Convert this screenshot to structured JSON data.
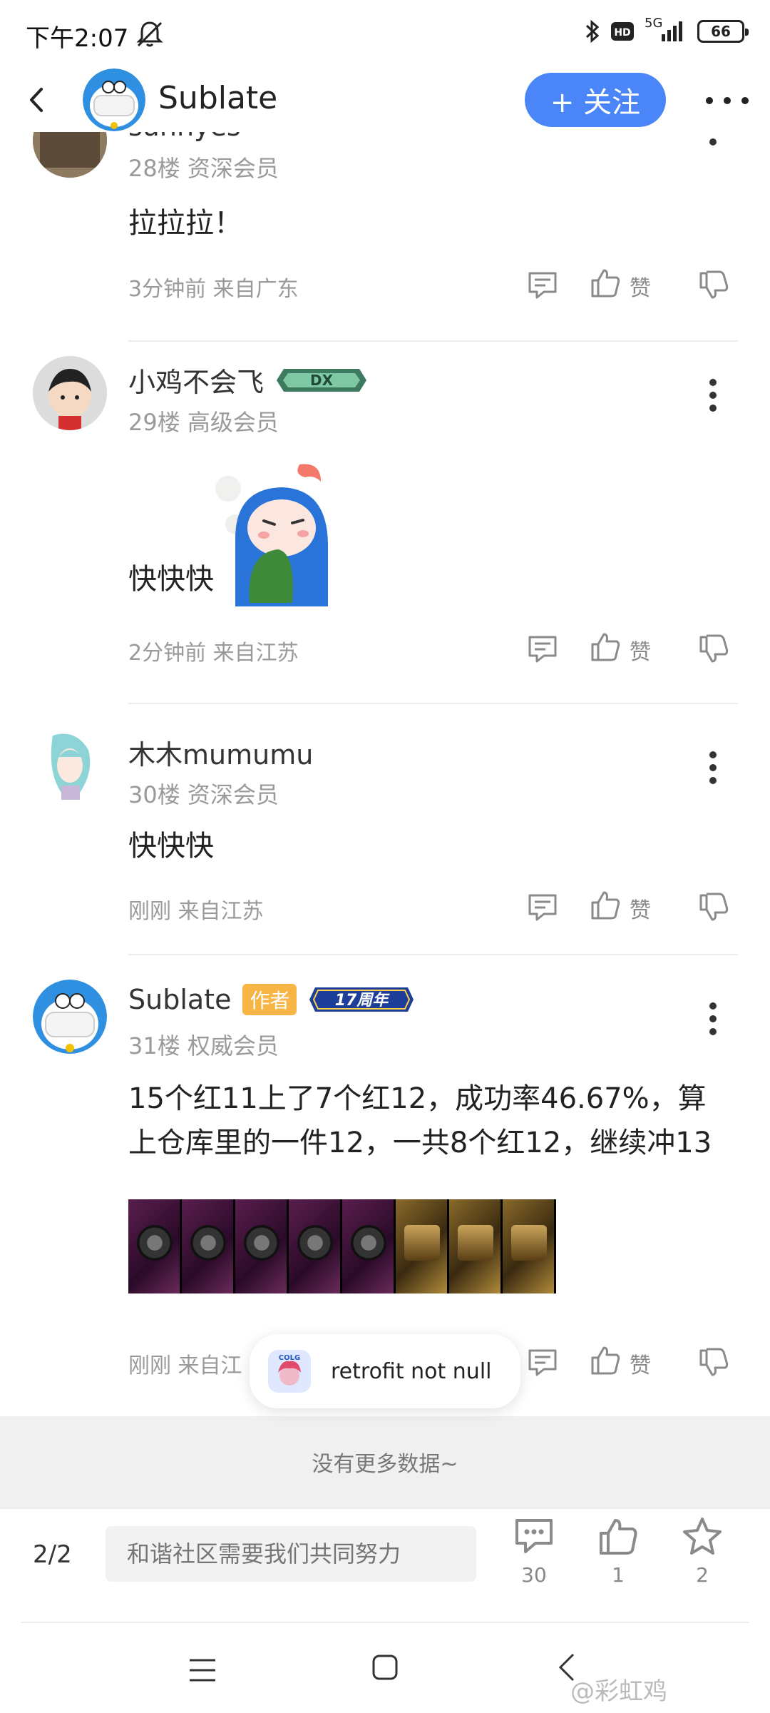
{
  "status": {
    "time": "下午2:07",
    "network": "5G",
    "battery": "66"
  },
  "header": {
    "title": "Sublate",
    "follow_label": "+ 关注"
  },
  "posts": [
    {
      "username": "sunnyes",
      "floor": "28楼 资深会员",
      "content": "拉拉拉！",
      "meta": "3分钟前 来自广东",
      "like_label": "赞"
    },
    {
      "username": "小鸡不会飞",
      "badge": "DX",
      "floor": "29楼 高级会员",
      "content": "快快快",
      "meta": "2分钟前 来自江苏",
      "like_label": "赞"
    },
    {
      "username": "木木mumumu",
      "floor": "30楼 资深会员",
      "content": "快快快",
      "meta": "刚刚 来自江苏",
      "like_label": "赞"
    },
    {
      "username": "Sublate",
      "author_badge": "作者",
      "anniv_badge": "17周年",
      "floor": "31楼 权威会员",
      "content": "15个红11上了7个红12，成功率46.67%，算上仓库里的一件12，一共8个红12，继续冲13",
      "meta": "刚刚 来自江",
      "like_label": "赞"
    }
  ],
  "toast": {
    "text": "retrofit not null",
    "app_label": "COLG"
  },
  "no_more": "没有更多数据~",
  "bottom": {
    "page_indicator": "2/2",
    "input_placeholder": "和谐社区需要我们共同努力",
    "comments": "30",
    "likes": "1",
    "stars": "2"
  },
  "watermark": "@彩虹鸡",
  "colors": {
    "accent": "#4a86f7",
    "author_badge": "#f6b545"
  }
}
